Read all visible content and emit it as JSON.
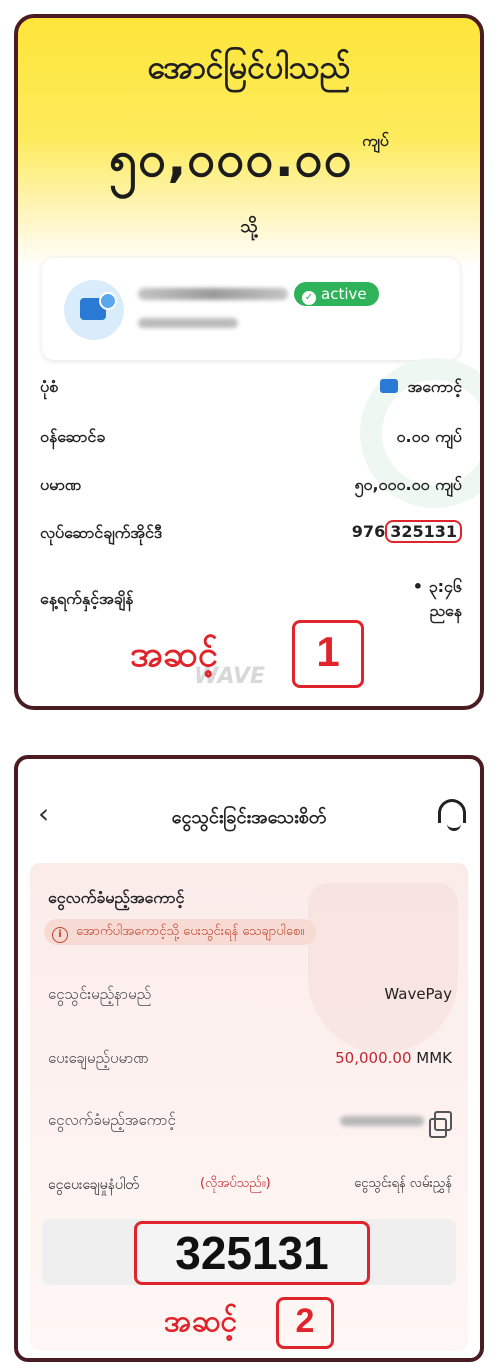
{
  "panel1": {
    "title": "အောင်မြင်ပါသည်",
    "amount": "၅၀,၀၀၀.၀၀",
    "currency": "ကျပ်",
    "to_label": "သို့",
    "status_badge": "active",
    "rows": [
      {
        "label": "ပုံစံ",
        "value": "အကောင့်"
      },
      {
        "label": "ဝန်ဆောင်ခ",
        "value": "၀.၀၀ ကျပ်"
      },
      {
        "label": "ပမာဏ",
        "value": "၅၀,၀၀၀.၀၀ ကျပ်"
      },
      {
        "label": "လုပ်ဆောင်ချက်အိုင်ဒီ",
        "value_prefix": "976",
        "value_highlight": "325131"
      },
      {
        "label": "နေ့ရက်နှင့်အချိန်",
        "value_line1": "• ၃:၄၆",
        "value_line2": "ညနေ"
      }
    ],
    "watermark": "WAVE",
    "step_label": "အဆင့်",
    "step_number": "1"
  },
  "panel2": {
    "back_icon": "‹",
    "title": "ငွေသွင်းခြင်းအသေးစိတ်",
    "section_title": "ငွေလက်ခံမည့်အကောင့်",
    "warning_text": "အောက်ပါအကောင့်သို့ ပေးသွင်းရန် သေချာပါစေ။",
    "rows": [
      {
        "label": "ငွေသွင်းမည့်နာမည်",
        "value": "WavePay"
      },
      {
        "label": "ပေးချေမည့်ပမာဏ",
        "amount": "50,000.00",
        "unit": "MMK"
      },
      {
        "label": "ငွေလက်ခံမည့်အကောင့်"
      }
    ],
    "slip_label": "ငွေပေးချေမှုနံပါတ်",
    "slip_required": "(လိုအပ်သည်။)",
    "slip_instruction": "ငွေသွင်းရန် လမ်းညွှန်",
    "reference_number": "325131",
    "step_label": "အဆင့်",
    "step_number": "2"
  },
  "colors": {
    "accent_red": "#e0242b",
    "frame": "#4a1c22",
    "yellow": "#fde53a",
    "active_green": "#2fb35a"
  }
}
